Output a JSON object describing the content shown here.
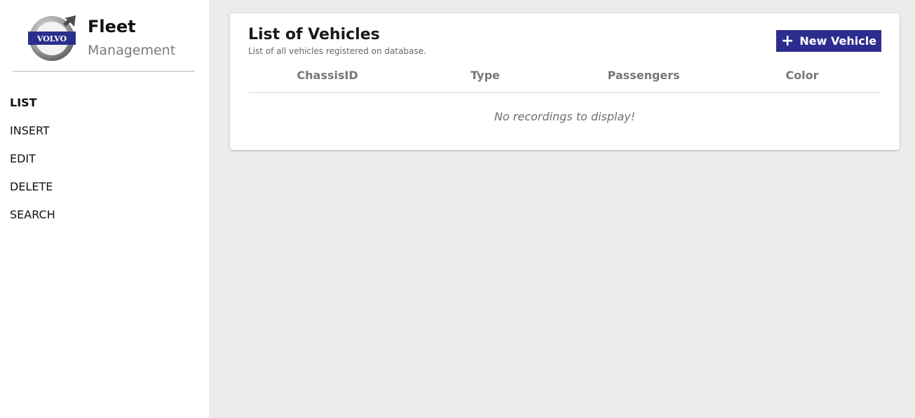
{
  "sidebar": {
    "brand": {
      "title": "Fleet",
      "subtitle": "Management",
      "logo_text": "VOLVO"
    },
    "nav": [
      {
        "label": "LIST",
        "active": true
      },
      {
        "label": "INSERT",
        "active": false
      },
      {
        "label": "EDIT",
        "active": false
      },
      {
        "label": "DELETE",
        "active": false
      },
      {
        "label": "SEARCH",
        "active": false
      }
    ]
  },
  "main": {
    "title": "List of Vehicles",
    "subtitle": "List of all vehicles registered on database.",
    "new_button": {
      "label": "New Vehicle",
      "icon": "plus-icon"
    },
    "table": {
      "columns": [
        "ChassisID",
        "Type",
        "Passengers",
        "Color"
      ],
      "rows": [],
      "empty_message": "No recordings to display!"
    }
  },
  "colors": {
    "accent": "#2c2c8f",
    "background": "#ececec",
    "sidebar": "#ffffff"
  }
}
